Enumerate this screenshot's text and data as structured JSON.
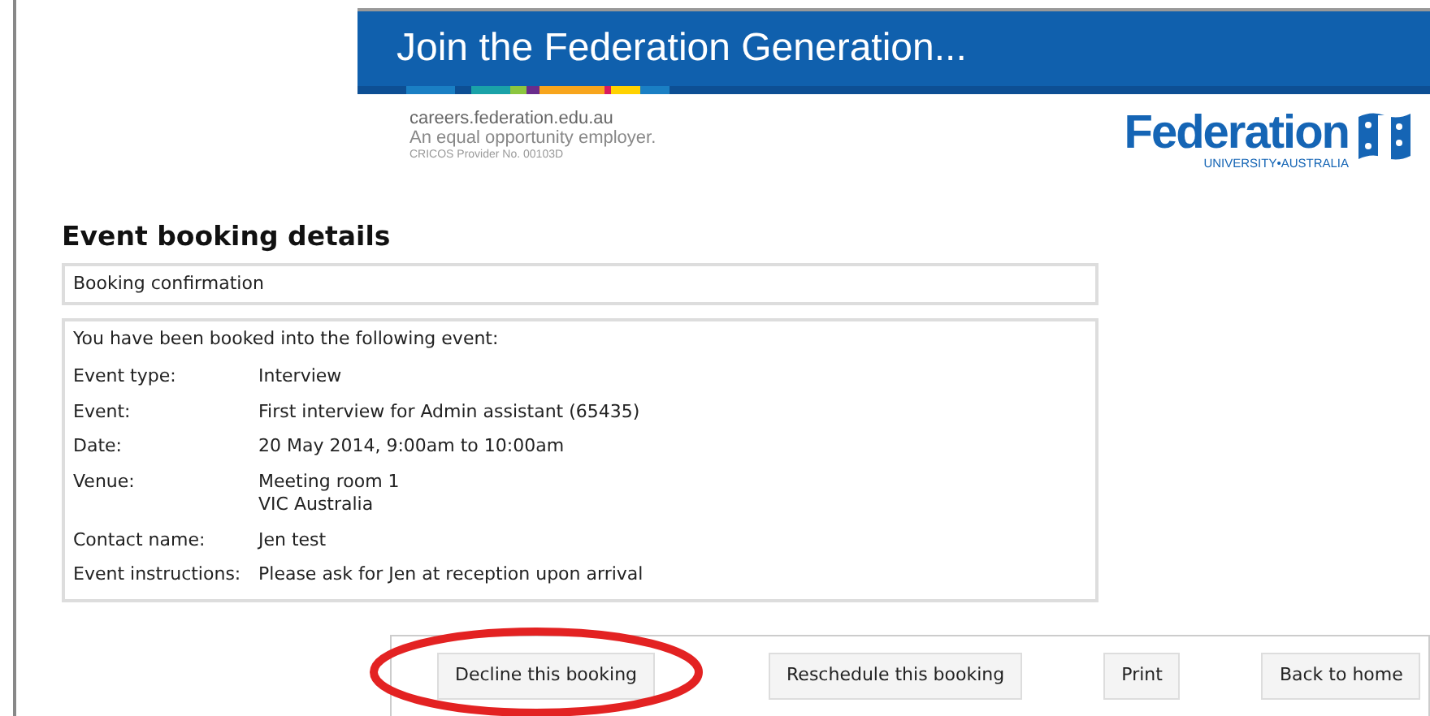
{
  "banner": {
    "title": "Join the Federation Generation...",
    "website": "careers.federation.edu.au",
    "tagline": "An equal opportunity employer.",
    "provider": "CRICOS Provider No. 00103D",
    "logo_name": "Federation",
    "logo_sub": "UNIVERSITY•AUSTRALIA"
  },
  "heading": "Event booking details",
  "confirmation_title": "Booking confirmation",
  "details": {
    "intro": "You have been booked into the following event:",
    "rows": [
      {
        "label": "Event type:",
        "lines": [
          "Interview"
        ]
      },
      {
        "label": "Event:",
        "lines": [
          "First interview for Admin assistant (65435)"
        ]
      },
      {
        "label": "Date:",
        "lines": [
          "20 May 2014, 9:00am to 10:00am"
        ]
      },
      {
        "label": "Venue:",
        "lines": [
          "Meeting room 1",
          "VIC Australia"
        ]
      },
      {
        "label": "Contact name:",
        "lines": [
          "Jen test"
        ]
      },
      {
        "label": "Event instructions:",
        "lines": [
          "Please ask for Jen at reception upon arrival"
        ]
      }
    ]
  },
  "buttons": [
    {
      "label": "Decline this booking",
      "highlighted": true
    },
    {
      "label": "Reschedule this booking",
      "highlighted": false
    },
    {
      "label": "Print",
      "highlighted": false
    },
    {
      "label": "Back to home",
      "highlighted": false
    }
  ]
}
